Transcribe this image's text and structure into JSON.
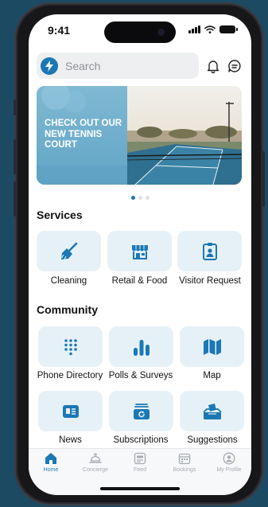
{
  "status": {
    "time": "9:41"
  },
  "search": {
    "placeholder": "Search"
  },
  "banner": {
    "text": "CHECK OUT OUR NEW TENNIS COURT"
  },
  "services": {
    "title": "Services",
    "items": [
      {
        "label": "Cleaning",
        "icon": "broom-icon"
      },
      {
        "label": "Retail & Food",
        "icon": "storefront-icon"
      },
      {
        "label": "Visitor Request",
        "icon": "badge-icon"
      }
    ]
  },
  "community": {
    "title": "Community",
    "items": [
      {
        "label": "Phone Directory",
        "icon": "dialpad-icon"
      },
      {
        "label": "Polls & Surveys",
        "icon": "bar-chart-icon"
      },
      {
        "label": "Map",
        "icon": "map-icon"
      },
      {
        "label": "News",
        "icon": "news-icon"
      },
      {
        "label": "Subscriptions",
        "icon": "subscription-icon"
      },
      {
        "label": "Suggestions",
        "icon": "ballot-box-icon"
      }
    ]
  },
  "tabs": [
    {
      "label": "Home",
      "icon": "home-icon",
      "active": true
    },
    {
      "label": "Concierge",
      "icon": "concierge-bell-icon",
      "active": false
    },
    {
      "label": "Feed",
      "icon": "feed-icon",
      "active": false
    },
    {
      "label": "Bookings",
      "icon": "calendar-icon",
      "active": false
    },
    {
      "label": "My Profile",
      "icon": "profile-icon",
      "active": false
    }
  ],
  "colors": {
    "accent": "#1b78b5",
    "tile_bg": "#e6f1f7",
    "background": "#1c4a63"
  }
}
